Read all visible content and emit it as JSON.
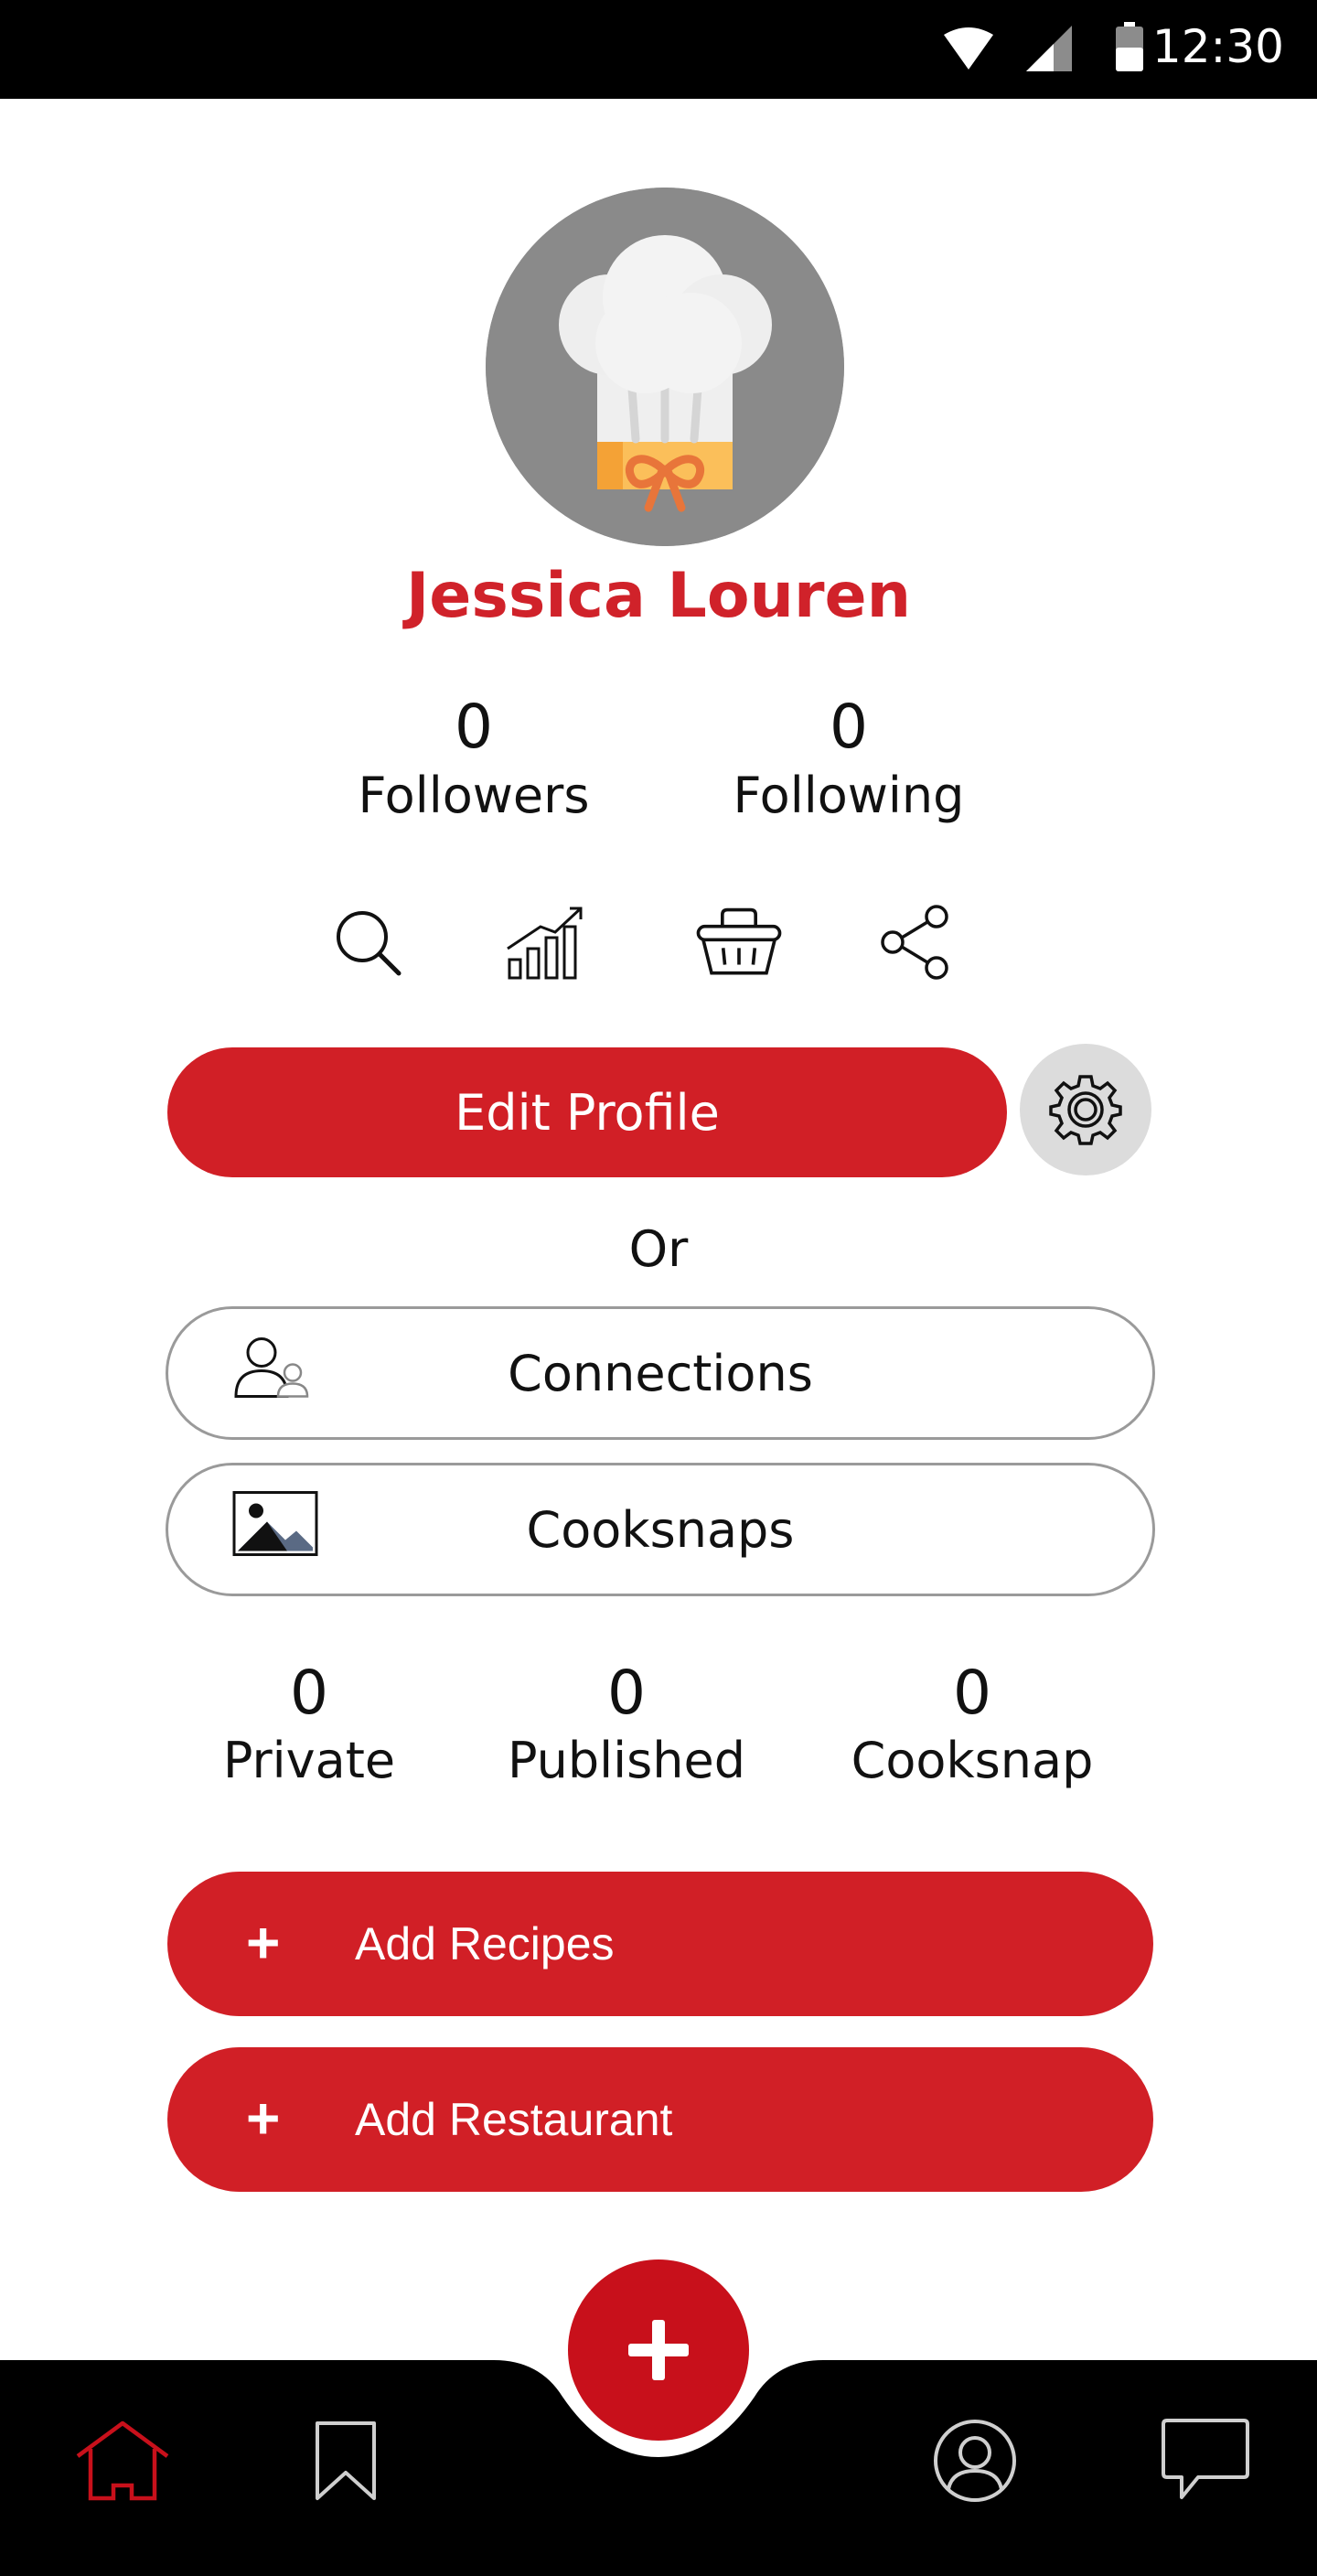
{
  "status_bar": {
    "time": "12:30",
    "icons": [
      "wifi-icon",
      "cell-signal-icon",
      "battery-icon"
    ]
  },
  "profile": {
    "name": "Jessica Louren",
    "avatar": "chef-hat-avatar",
    "followers": {
      "count": "0",
      "label": "Followers"
    },
    "following": {
      "count": "0",
      "label": "Following"
    }
  },
  "quick_actions": [
    "search-icon",
    "growth-chart-icon",
    "basket-icon",
    "share-icon"
  ],
  "buttons": {
    "edit_profile": "Edit Profile",
    "or": "Or",
    "connections": "Connections",
    "cooksnaps": "Cooksnaps",
    "add_recipes": "Add Recipes",
    "add_restaurant": "Add Restaurant",
    "plus": "+"
  },
  "counts": [
    {
      "num": "0",
      "label": "Private"
    },
    {
      "num": "0",
      "label": "Published"
    },
    {
      "num": "0",
      "label": "Cooksnap"
    }
  ],
  "bottom_nav": {
    "items": [
      "home-icon",
      "bookmark-icon",
      "fab-add-icon",
      "profile-icon",
      "chat-icon"
    ],
    "active": "home-icon"
  },
  "colors": {
    "brand_red": "#d11f26",
    "fab_red": "#c8101b",
    "avatar_gray": "#8a8a8a",
    "settings_gray": "#dcdcdc"
  }
}
